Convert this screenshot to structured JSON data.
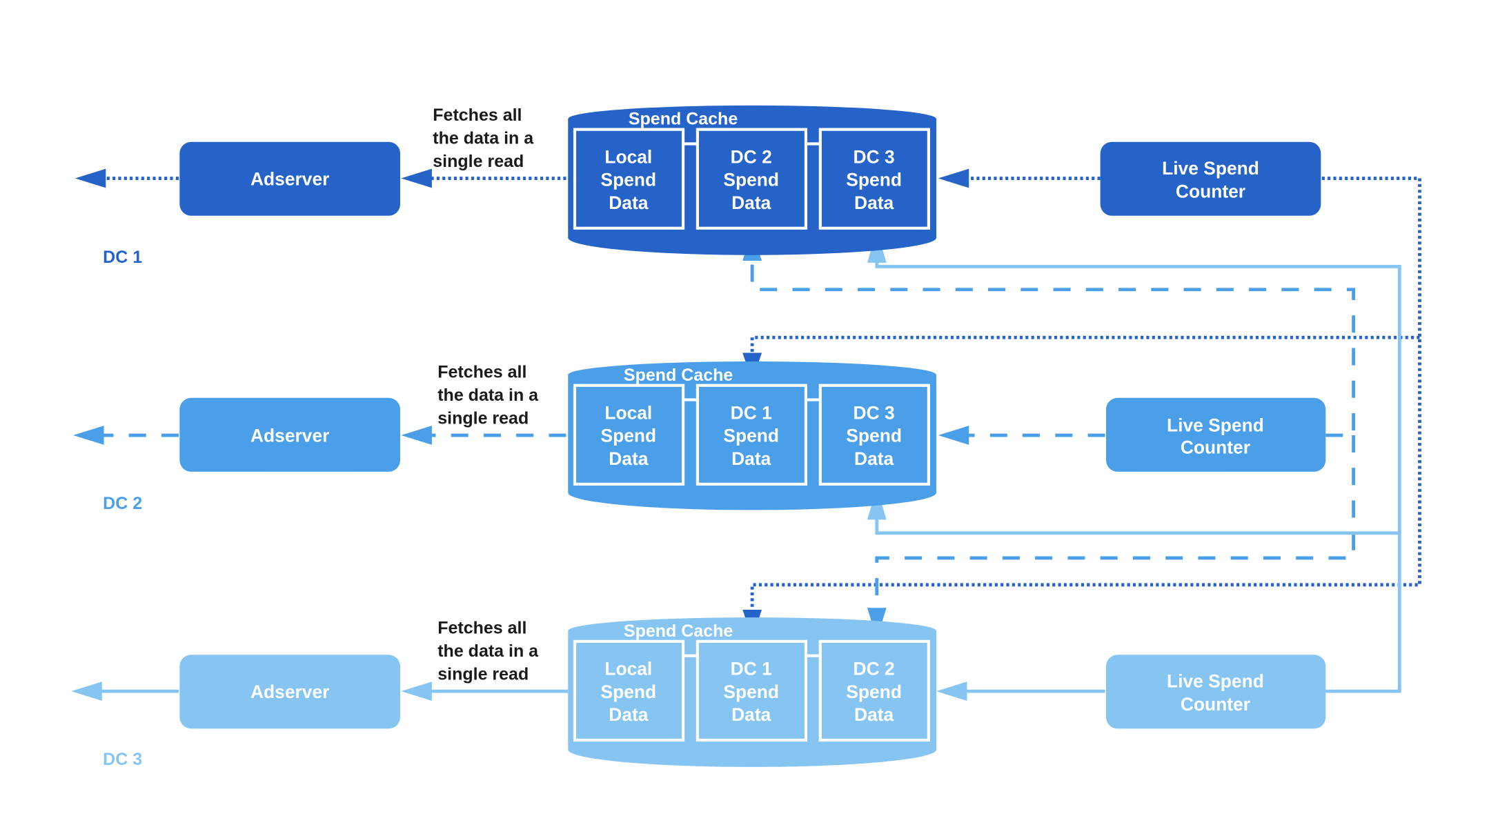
{
  "colors": {
    "dc1": "#2563C9",
    "dc2": "#4A9FE8",
    "dc3": "#86C5F2",
    "annotation_text": "#1a1a1a",
    "background": "#ffffff"
  },
  "rows": [
    {
      "dc_label": "DC 1",
      "adserver": "Adserver",
      "annotation": [
        "Fetches all",
        "the data in a",
        "single read"
      ],
      "cache_title": "Spend Cache",
      "cells": [
        [
          "Local",
          "Spend",
          "Data"
        ],
        [
          "DC 2",
          "Spend",
          "Data"
        ],
        [
          "DC 3",
          "Spend",
          "Data"
        ]
      ],
      "counter": [
        "Live Spend",
        "Counter"
      ],
      "line_style": "dotted"
    },
    {
      "dc_label": "DC 2",
      "adserver": "Adserver",
      "annotation": [
        "Fetches all",
        "the data in a",
        "single read"
      ],
      "cache_title": "Spend Cache",
      "cells": [
        [
          "Local",
          "Spend",
          "Data"
        ],
        [
          "DC 1",
          "Spend",
          "Data"
        ],
        [
          "DC 3",
          "Spend",
          "Data"
        ]
      ],
      "counter": [
        "Live Spend",
        "Counter"
      ],
      "line_style": "dashed"
    },
    {
      "dc_label": "DC 3",
      "adserver": "Adserver",
      "annotation": [
        "Fetches all",
        "the data in a",
        "single read"
      ],
      "cache_title": "Spend Cache",
      "cells": [
        [
          "Local",
          "Spend",
          "Data"
        ],
        [
          "DC 1",
          "Spend",
          "Data"
        ],
        [
          "DC 2",
          "Spend",
          "Data"
        ]
      ],
      "counter": [
        "Live Spend",
        "Counter"
      ],
      "line_style": "solid"
    }
  ]
}
